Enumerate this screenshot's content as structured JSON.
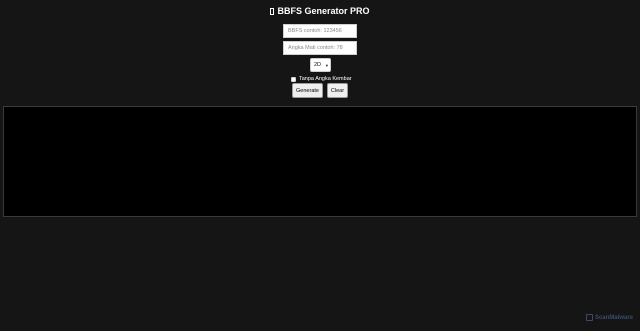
{
  "header": {
    "title": "BBFS Generator PRO",
    "title_icon": "app-icon"
  },
  "form": {
    "bbfs_placeholder": "BBFS contoh: 123456",
    "mati_placeholder": "Angka Mati contoh: 78",
    "digit_select_value": "2D",
    "no_twin_label": "Tanpa Angka Kembar",
    "generate_label": "Generate",
    "clear_label": "Clear"
  },
  "output": {
    "text": ""
  },
  "watermark": {
    "text": "ScanMalware"
  }
}
